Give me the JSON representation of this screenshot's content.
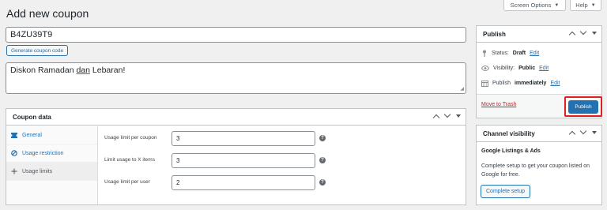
{
  "topbar": {
    "screen_options_label": "Screen Options",
    "help_label": "Help"
  },
  "page": {
    "title": "Add new coupon",
    "coupon_code": "B4ZU39T9",
    "generate_button": "Generate coupon code",
    "description_parts": [
      "Diskon Ramadan ",
      "dan",
      " Lebaran!"
    ]
  },
  "coupon_data": {
    "title": "Coupon data",
    "tabs": [
      {
        "label": "General",
        "icon": "ticket-icon"
      },
      {
        "label": "Usage restriction",
        "icon": "block-icon"
      },
      {
        "label": "Usage limits",
        "icon": "plus-icon"
      }
    ],
    "fields": [
      {
        "label": "Usage limit per coupon",
        "value": "3"
      },
      {
        "label": "Limit usage to X items",
        "value": "3"
      },
      {
        "label": "Usage limit per user",
        "value": "2"
      }
    ],
    "help_glyph": "?"
  },
  "publish": {
    "title": "Publish",
    "status_label": "Status:",
    "status_value": "Draft",
    "visibility_label": "Visibility:",
    "visibility_value": "Public",
    "schedule_label": "Publish",
    "schedule_value": "immediately",
    "edit_link": "Edit",
    "trash_link": "Move to Trash",
    "publish_button": "Publish"
  },
  "channel": {
    "title": "Channel visibility",
    "subtitle": "Google Listings & Ads",
    "text": "Complete setup to get your coupon listed on Google for free.",
    "button": "Complete setup"
  },
  "colors": {
    "accent": "#2271b1",
    "highlight": "#e02020",
    "trash": "#b32d2e",
    "background": "#f0f0f1"
  }
}
